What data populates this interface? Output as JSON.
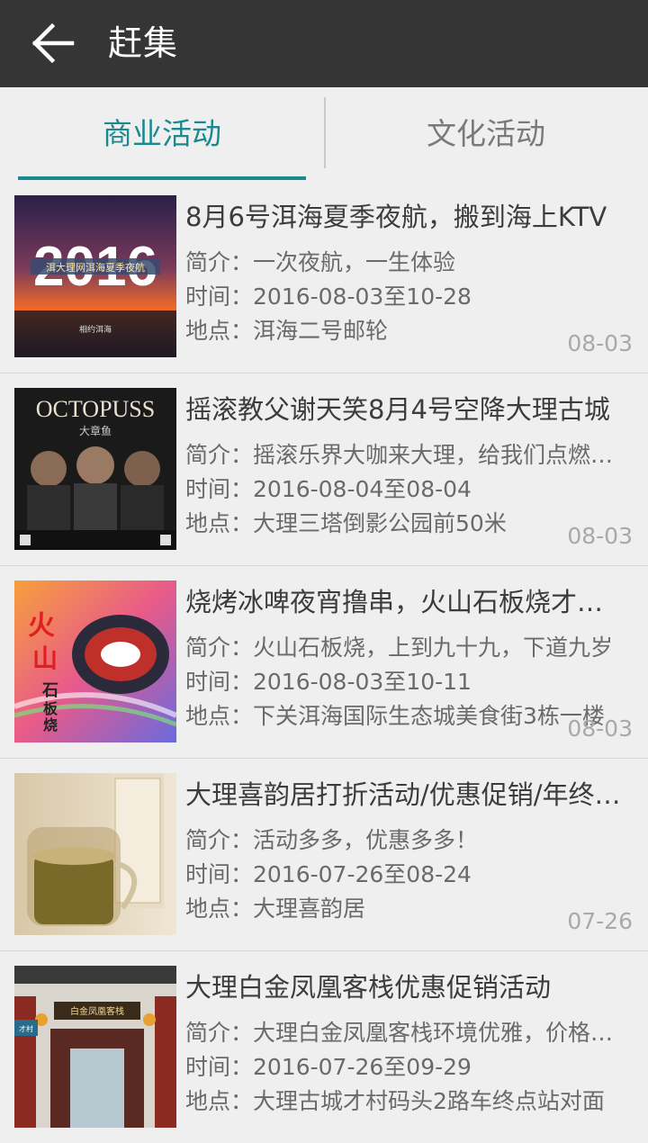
{
  "appbar": {
    "title": "赶集",
    "back_icon": "arrow-left-icon"
  },
  "tabs": [
    {
      "label": "商业活动",
      "active": true
    },
    {
      "label": "文化活动",
      "active": false
    }
  ],
  "colors": {
    "accent": "#1b8a90",
    "appbar": "#353535",
    "background": "#efefef"
  },
  "items": [
    {
      "title": "8月6号洱海夏季夜航，搬到海上KTV",
      "intro": "简介：一次夜航，一生体验",
      "time": "时间：2016-08-03至10-28",
      "place": "地点：洱海二号邮轮",
      "date": "08-03",
      "thumb_text": [
        "2016",
        "洱大理网洱海夏季夜航",
        "相约洱海"
      ]
    },
    {
      "title": "摇滚教父谢天笑8月4号空降大理古城",
      "intro": "简介：摇滚乐界大咖来大理，给我们点燃激情",
      "time": "时间：2016-08-04至08-04",
      "place": "地点：大理三塔倒影公园前50米",
      "date": "08-03",
      "thumb_text": [
        "OCTOPUSS",
        "大章鱼"
      ]
    },
    {
      "title": "烧烤冰啤夜宵撸串，火山石板烧才是王道",
      "intro": "简介：火山石板烧，上到九十九，下道九岁",
      "time": "时间：2016-08-03至10-11",
      "place": "地点：下关洱海国际生态城美食街3栋一楼",
      "date": "08-03",
      "thumb_text": [
        "火",
        "山",
        "石",
        "板",
        "烧"
      ]
    },
    {
      "title": "大理喜韵居打折活动/优惠促销/年终大促",
      "intro": "简介：活动多多，优惠多多！",
      "time": "时间：2016-07-26至08-24",
      "place": "地点：大理喜韵居",
      "date": "07-26",
      "thumb_text": []
    },
    {
      "title": "大理白金凤凰客栈优惠促销活动",
      "intro": "简介：大理白金凤凰客栈环境优雅，价格实惠",
      "time": "时间：2016-07-26至09-29",
      "place": "地点：大理古城才村码头2路车终点站对面",
      "date": "",
      "thumb_text": [
        "白金凤凰客栈",
        "才村"
      ]
    }
  ]
}
